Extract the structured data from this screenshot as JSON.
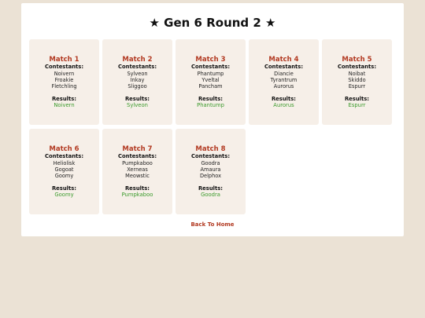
{
  "page": {
    "title": "★ Gen 6 Round 2 ★",
    "back_link": "Back To Home"
  },
  "labels": {
    "contestants": "Contestants:",
    "results": "Results:"
  },
  "matches": [
    {
      "title": "Match 1",
      "contestants": [
        "Noivern",
        "Froakie",
        "Fletchling"
      ],
      "result": "Noivern"
    },
    {
      "title": "Match 2",
      "contestants": [
        "Sylveon",
        "Inkay",
        "Sliggoo"
      ],
      "result": "Sylveon"
    },
    {
      "title": "Match 3",
      "contestants": [
        "Phantump",
        "Yveltal",
        "Pancham"
      ],
      "result": "Phantump"
    },
    {
      "title": "Match 4",
      "contestants": [
        "Diancie",
        "Tyrantrum",
        "Aurorus"
      ],
      "result": "Aurorus"
    },
    {
      "title": "Match 5",
      "contestants": [
        "Noibat",
        "Skiddo",
        "Espurr"
      ],
      "result": "Espurr"
    },
    {
      "title": "Match 6",
      "contestants": [
        "Heliolisk",
        "Gogoat",
        "Goomy"
      ],
      "result": "Goomy"
    },
    {
      "title": "Match 7",
      "contestants": [
        "Pumpkaboo",
        "Xerneas",
        "Meowstic"
      ],
      "result": "Pumpkaboo"
    },
    {
      "title": "Match 8",
      "contestants": [
        "Goodra",
        "Amaura",
        "Delphox"
      ],
      "result": "Goodra"
    }
  ],
  "colors": {
    "match_title": "#b23a22",
    "result": "#3a9a2b",
    "card_bg": "#f6efe8",
    "page_bg": "#ebe2d5"
  }
}
